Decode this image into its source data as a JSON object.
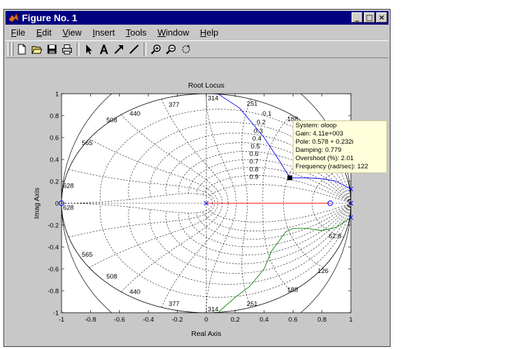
{
  "window": {
    "title": "Figure No. 1",
    "minimize_glyph": "_",
    "maximize_glyph": "□",
    "close_glyph": "×"
  },
  "menu": {
    "items": [
      {
        "u": "F",
        "rest": "ile"
      },
      {
        "u": "E",
        "rest": "dit"
      },
      {
        "u": "V",
        "rest": "iew"
      },
      {
        "u": "I",
        "rest": "nsert"
      },
      {
        "u": "T",
        "rest": "ools"
      },
      {
        "u": "W",
        "rest": "indow"
      },
      {
        "u": "H",
        "rest": "elp"
      }
    ]
  },
  "toolbar": {
    "icons": [
      "new-file-icon",
      "open-folder-icon",
      "save-icon",
      "print-icon",
      "select-arrow-icon",
      "insert-text-icon",
      "insert-arrow-icon",
      "insert-line-icon",
      "zoom-in-icon",
      "zoom-out-icon",
      "rotate-icon"
    ]
  },
  "chart_data": {
    "type": "scatter",
    "title": "Root Locus",
    "xlabel": "Real Axis",
    "ylabel": "Imag Axis",
    "xlim": [
      -1,
      1
    ],
    "ylim": [
      -1,
      1
    ],
    "xticks": [
      "-1",
      "-0.8",
      "-0.6",
      "-0.4",
      "-0.2",
      "0",
      "0.2",
      "0.4",
      "0.6",
      "0.8",
      "1"
    ],
    "yticks": [
      "1",
      "0.8",
      "0.6",
      "0.4",
      "0.2",
      "0",
      "-0.2",
      "-0.4",
      "-0.6",
      "-0.8",
      "-1"
    ],
    "grid": "z-plane damping and natural frequency grid",
    "damping_labels": [
      "0.1",
      "0.2",
      "0.3",
      "0.4",
      "0.5",
      "0.6",
      "0.7",
      "0.8",
      "0.9"
    ],
    "frequency_labels": [
      "628",
      "565",
      "508",
      "440",
      "377",
      "314",
      "251",
      "188",
      "126",
      "62.8"
    ],
    "zeros": [
      [
        -1,
        0
      ],
      [
        0.857,
        0
      ]
    ],
    "poles": [
      [
        0,
        0
      ],
      [
        1,
        0.13
      ],
      [
        1,
        -0.13
      ],
      [
        1,
        0
      ]
    ],
    "series": [
      {
        "color": "#0000ff",
        "x": [
          0.08,
          0.23,
          0.3,
          0.4,
          0.5,
          0.578,
          0.6,
          0.7,
          0.8,
          0.9,
          1.0
        ],
        "y": [
          1.0,
          0.87,
          0.76,
          0.6,
          0.4,
          0.232,
          0.232,
          0.232,
          0.225,
          0.2,
          0.13
        ]
      },
      {
        "color": "#008000",
        "x": [
          0.08,
          0.2,
          0.3,
          0.4,
          0.45,
          0.5,
          0.55,
          0.6,
          0.7,
          0.8,
          0.9,
          1.0
        ],
        "y": [
          -1.0,
          -0.86,
          -0.76,
          -0.6,
          -0.44,
          -0.35,
          -0.26,
          -0.23,
          -0.23,
          -0.25,
          -0.22,
          -0.13
        ]
      },
      {
        "color": "#ff0000",
        "x": [
          0.0,
          0.857
        ],
        "y": [
          0.0,
          0.0
        ]
      }
    ],
    "selected_point": [
      0.578,
      0.232
    ]
  },
  "datatip": {
    "lines": [
      "System: oloop",
      "Gain: 4.11e+003",
      "Pole: 0.578 + 0.232i",
      "Damping: 0.779",
      "Overshoot (%): 2.01",
      "Frequency (rad/sec): 122"
    ]
  }
}
